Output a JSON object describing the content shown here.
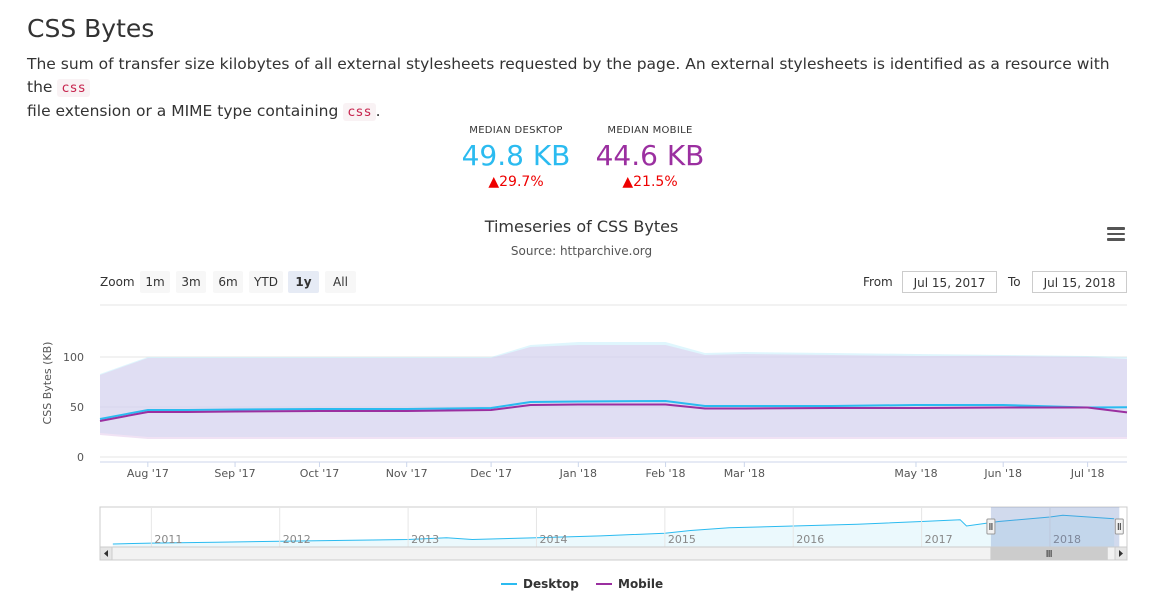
{
  "page": {
    "title": "CSS Bytes",
    "description_before_code1": "The sum of transfer size kilobytes of all external stylesheets requested by the page. An external stylesheets is identified as a resource with the ",
    "code1": "css",
    "description_between": " file extension or a MIME type containing ",
    "code2": "css",
    "description_after": "."
  },
  "metrics": {
    "desktop": {
      "label": "MEDIAN DESKTOP",
      "value": "49.8 KB",
      "change": "▲29.7%",
      "color": "#2bbbf0"
    },
    "mobile": {
      "label": "MEDIAN MOBILE",
      "value": "44.6 KB",
      "change": "▲21.5%",
      "color": "#9b2fa0"
    }
  },
  "toolbar": {
    "zoom_label": "Zoom",
    "zoom_buttons": [
      "1m",
      "3m",
      "6m",
      "YTD",
      "1y",
      "All"
    ],
    "active_zoom": "1y",
    "from_label": "From",
    "from_value": "Jul 15, 2017",
    "to_label": "To",
    "to_value": "Jul 15, 2018"
  },
  "chart_data": {
    "type": "line",
    "title": "Timeseries of CSS Bytes",
    "subtitle": "Source: httparchive.org",
    "ylabel": "CSS Bytes (KB)",
    "ylim": [
      0,
      100
    ],
    "yticks": [
      0,
      50,
      100
    ],
    "x_ticks": [
      "Aug '17",
      "Sep '17",
      "Oct '17",
      "Nov '17",
      "Dec '17",
      "Jan '18",
      "Feb '18",
      "Mar '18",
      "May '18",
      "Jun '18",
      "Jul '18"
    ],
    "x_dates": [
      "2017-07-15",
      "2017-08-01",
      "2017-08-15",
      "2017-09-01",
      "2017-10-01",
      "2017-11-01",
      "2017-12-01",
      "2017-12-15",
      "2018-01-01",
      "2018-02-01",
      "2018-02-15",
      "2018-03-01",
      "2018-04-01",
      "2018-05-01",
      "2018-06-01",
      "2018-07-01",
      "2018-07-15"
    ],
    "series": [
      {
        "name": "Desktop",
        "color": "#2bbbf0",
        "values": [
          38,
          47,
          47,
          47.5,
          48,
          48,
          49,
          55,
          55.5,
          56,
          51,
          51,
          51,
          52,
          52,
          49.5,
          49.8
        ],
        "band_low": [
          24,
          20,
          20,
          20,
          20,
          20,
          20,
          20,
          20,
          20,
          20,
          20,
          20,
          20,
          20,
          20,
          20
        ],
        "band_high": [
          83,
          100,
          100,
          100,
          100,
          100,
          100,
          112,
          115,
          115,
          104,
          105,
          104,
          103,
          102,
          101,
          100
        ]
      },
      {
        "name": "Mobile",
        "color": "#9b2fa0",
        "values": [
          36,
          45,
          45,
          45.5,
          46,
          46,
          47,
          52,
          52.5,
          52.5,
          48.5,
          48.5,
          49,
          49,
          49.5,
          49.5,
          44.6
        ],
        "band_low": [
          22,
          18,
          18,
          18,
          18,
          18,
          18,
          18,
          18,
          18,
          18,
          18,
          18,
          18,
          18,
          18,
          18
        ],
        "band_high": [
          82,
          99,
          99,
          99,
          99,
          99,
          99,
          110,
          112,
          112,
          102,
          103,
          102,
          101,
          101,
          100,
          98
        ]
      }
    ],
    "navigator": {
      "labels": [
        "2011",
        "2012",
        "2013",
        "2014",
        "2015",
        "2016",
        "2017",
        "2018"
      ],
      "years": [
        2010.7,
        2011.0,
        2011.5,
        2012.0,
        2012.5,
        2013.0,
        2013.3,
        2013.5,
        2014.0,
        2014.5,
        2015.0,
        2015.2,
        2015.5,
        2016.0,
        2016.5,
        2017.0,
        2017.3,
        2017.35,
        2017.6,
        2018.0,
        2018.1,
        2018.5
      ],
      "values": [
        0,
        1,
        2,
        3,
        4,
        5,
        7,
        5,
        7,
        9,
        12,
        15,
        18,
        20,
        22,
        25,
        27,
        20,
        25,
        30,
        32,
        28
      ],
      "selected_range": [
        2017.54,
        2018.54
      ]
    }
  },
  "legend": [
    {
      "name": "Desktop",
      "color": "#2bbbf0"
    },
    {
      "name": "Mobile",
      "color": "#9b2fa0"
    }
  ]
}
